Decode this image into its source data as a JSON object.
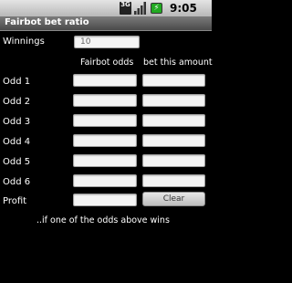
{
  "status_bar": {
    "network_label": "3G",
    "time": "9:05 pm",
    "icons": [
      "3g-icon",
      "signal-icon",
      "battery-icon"
    ]
  },
  "title": "Fairbot bet ratio",
  "winnings": {
    "label": "Winnings",
    "value": "10"
  },
  "columns": {
    "odds": "Fairbot odds",
    "bet": "bet this amount"
  },
  "rows": [
    {
      "label": "Odd 1",
      "odds": "",
      "bet": ""
    },
    {
      "label": "Odd 2",
      "odds": "",
      "bet": ""
    },
    {
      "label": "Odd 3",
      "odds": "",
      "bet": ""
    },
    {
      "label": "Odd 4",
      "odds": "",
      "bet": ""
    },
    {
      "label": "Odd 5",
      "odds": "",
      "bet": ""
    },
    {
      "label": "Odd 6",
      "odds": "",
      "bet": ""
    }
  ],
  "profit": {
    "label": "Profit",
    "value": ""
  },
  "button_label": "Clear",
  "footer_note": "..if one of the odds above wins"
}
